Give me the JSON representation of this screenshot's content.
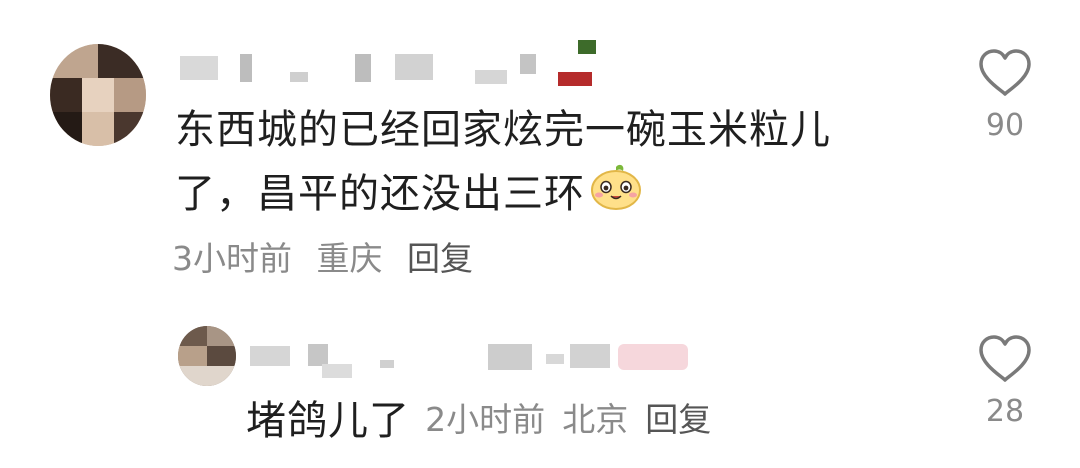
{
  "comments": [
    {
      "text_line1": "东西城的已经回家炫完一碗玉米粒儿",
      "text_line2": "了，昌平的还没出三环",
      "emoji_icon": "corn-face-emoji",
      "time": "3小时前",
      "location": "重庆",
      "reply_label": "回复",
      "likes": "90"
    },
    {
      "text": "堵鸽儿了",
      "time": "2小时前",
      "location": "北京",
      "reply_label": "回复",
      "likes": "28"
    }
  ],
  "colors": {
    "text": "#1f1f1f",
    "meta": "#8a8a8a",
    "icon": "#7a7a7a"
  }
}
